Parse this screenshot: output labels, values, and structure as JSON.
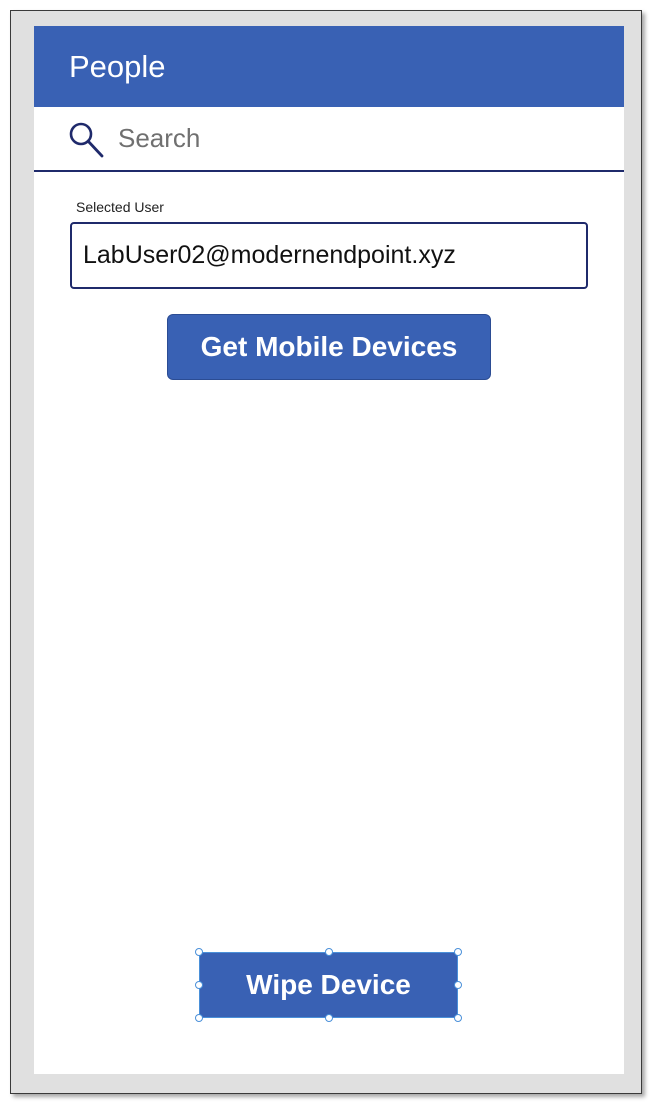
{
  "header": {
    "title": "People"
  },
  "search": {
    "placeholder": "Search",
    "value": ""
  },
  "selected_user": {
    "label": "Selected User",
    "value": "LabUser02@modernendpoint.xyz"
  },
  "buttons": {
    "get_devices_label": "Get Mobile Devices",
    "wipe_device_label": "Wipe Device"
  },
  "icons": {
    "search": "search-icon"
  },
  "colors": {
    "header_bg": "#3961b4",
    "button_bg": "#3961b4",
    "border_accent": "#1f2a6b",
    "selection_handle": "#4a90d9"
  }
}
